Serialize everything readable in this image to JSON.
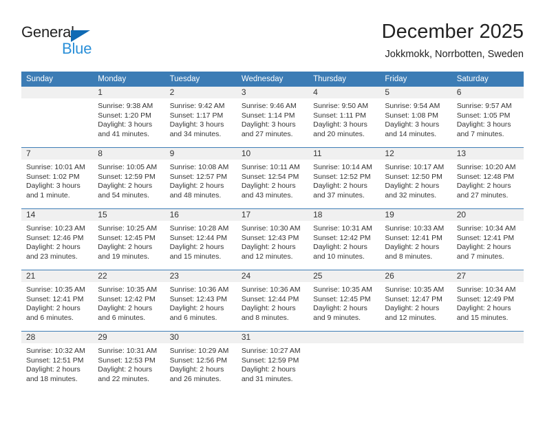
{
  "brand": {
    "name_top": "General",
    "name_bottom": "Blue",
    "accent_color": "#0f6ab4",
    "blue_text_color": "#2a8fd8"
  },
  "header": {
    "month_title": "December 2025",
    "location": "Jokkmokk, Norrbotten, Sweden"
  },
  "calendar": {
    "header_bg": "#3c7cb5",
    "daynum_band_bg": "#f0f0f0",
    "weekday_headers": [
      "Sunday",
      "Monday",
      "Tuesday",
      "Wednesday",
      "Thursday",
      "Friday",
      "Saturday"
    ],
    "weeks": [
      [
        {
          "day": "",
          "lines": []
        },
        {
          "day": "1",
          "lines": [
            "Sunrise: 9:38 AM",
            "Sunset: 1:20 PM",
            "Daylight: 3 hours",
            "and 41 minutes."
          ]
        },
        {
          "day": "2",
          "lines": [
            "Sunrise: 9:42 AM",
            "Sunset: 1:17 PM",
            "Daylight: 3 hours",
            "and 34 minutes."
          ]
        },
        {
          "day": "3",
          "lines": [
            "Sunrise: 9:46 AM",
            "Sunset: 1:14 PM",
            "Daylight: 3 hours",
            "and 27 minutes."
          ]
        },
        {
          "day": "4",
          "lines": [
            "Sunrise: 9:50 AM",
            "Sunset: 1:11 PM",
            "Daylight: 3 hours",
            "and 20 minutes."
          ]
        },
        {
          "day": "5",
          "lines": [
            "Sunrise: 9:54 AM",
            "Sunset: 1:08 PM",
            "Daylight: 3 hours",
            "and 14 minutes."
          ]
        },
        {
          "day": "6",
          "lines": [
            "Sunrise: 9:57 AM",
            "Sunset: 1:05 PM",
            "Daylight: 3 hours",
            "and 7 minutes."
          ]
        }
      ],
      [
        {
          "day": "7",
          "lines": [
            "Sunrise: 10:01 AM",
            "Sunset: 1:02 PM",
            "Daylight: 3 hours",
            "and 1 minute."
          ]
        },
        {
          "day": "8",
          "lines": [
            "Sunrise: 10:05 AM",
            "Sunset: 12:59 PM",
            "Daylight: 2 hours",
            "and 54 minutes."
          ]
        },
        {
          "day": "9",
          "lines": [
            "Sunrise: 10:08 AM",
            "Sunset: 12:57 PM",
            "Daylight: 2 hours",
            "and 48 minutes."
          ]
        },
        {
          "day": "10",
          "lines": [
            "Sunrise: 10:11 AM",
            "Sunset: 12:54 PM",
            "Daylight: 2 hours",
            "and 43 minutes."
          ]
        },
        {
          "day": "11",
          "lines": [
            "Sunrise: 10:14 AM",
            "Sunset: 12:52 PM",
            "Daylight: 2 hours",
            "and 37 minutes."
          ]
        },
        {
          "day": "12",
          "lines": [
            "Sunrise: 10:17 AM",
            "Sunset: 12:50 PM",
            "Daylight: 2 hours",
            "and 32 minutes."
          ]
        },
        {
          "day": "13",
          "lines": [
            "Sunrise: 10:20 AM",
            "Sunset: 12:48 PM",
            "Daylight: 2 hours",
            "and 27 minutes."
          ]
        }
      ],
      [
        {
          "day": "14",
          "lines": [
            "Sunrise: 10:23 AM",
            "Sunset: 12:46 PM",
            "Daylight: 2 hours",
            "and 23 minutes."
          ]
        },
        {
          "day": "15",
          "lines": [
            "Sunrise: 10:25 AM",
            "Sunset: 12:45 PM",
            "Daylight: 2 hours",
            "and 19 minutes."
          ]
        },
        {
          "day": "16",
          "lines": [
            "Sunrise: 10:28 AM",
            "Sunset: 12:44 PM",
            "Daylight: 2 hours",
            "and 15 minutes."
          ]
        },
        {
          "day": "17",
          "lines": [
            "Sunrise: 10:30 AM",
            "Sunset: 12:43 PM",
            "Daylight: 2 hours",
            "and 12 minutes."
          ]
        },
        {
          "day": "18",
          "lines": [
            "Sunrise: 10:31 AM",
            "Sunset: 12:42 PM",
            "Daylight: 2 hours",
            "and 10 minutes."
          ]
        },
        {
          "day": "19",
          "lines": [
            "Sunrise: 10:33 AM",
            "Sunset: 12:41 PM",
            "Daylight: 2 hours",
            "and 8 minutes."
          ]
        },
        {
          "day": "20",
          "lines": [
            "Sunrise: 10:34 AM",
            "Sunset: 12:41 PM",
            "Daylight: 2 hours",
            "and 7 minutes."
          ]
        }
      ],
      [
        {
          "day": "21",
          "lines": [
            "Sunrise: 10:35 AM",
            "Sunset: 12:41 PM",
            "Daylight: 2 hours",
            "and 6 minutes."
          ]
        },
        {
          "day": "22",
          "lines": [
            "Sunrise: 10:35 AM",
            "Sunset: 12:42 PM",
            "Daylight: 2 hours",
            "and 6 minutes."
          ]
        },
        {
          "day": "23",
          "lines": [
            "Sunrise: 10:36 AM",
            "Sunset: 12:43 PM",
            "Daylight: 2 hours",
            "and 6 minutes."
          ]
        },
        {
          "day": "24",
          "lines": [
            "Sunrise: 10:36 AM",
            "Sunset: 12:44 PM",
            "Daylight: 2 hours",
            "and 8 minutes."
          ]
        },
        {
          "day": "25",
          "lines": [
            "Sunrise: 10:35 AM",
            "Sunset: 12:45 PM",
            "Daylight: 2 hours",
            "and 9 minutes."
          ]
        },
        {
          "day": "26",
          "lines": [
            "Sunrise: 10:35 AM",
            "Sunset: 12:47 PM",
            "Daylight: 2 hours",
            "and 12 minutes."
          ]
        },
        {
          "day": "27",
          "lines": [
            "Sunrise: 10:34 AM",
            "Sunset: 12:49 PM",
            "Daylight: 2 hours",
            "and 15 minutes."
          ]
        }
      ],
      [
        {
          "day": "28",
          "lines": [
            "Sunrise: 10:32 AM",
            "Sunset: 12:51 PM",
            "Daylight: 2 hours",
            "and 18 minutes."
          ]
        },
        {
          "day": "29",
          "lines": [
            "Sunrise: 10:31 AM",
            "Sunset: 12:53 PM",
            "Daylight: 2 hours",
            "and 22 minutes."
          ]
        },
        {
          "day": "30",
          "lines": [
            "Sunrise: 10:29 AM",
            "Sunset: 12:56 PM",
            "Daylight: 2 hours",
            "and 26 minutes."
          ]
        },
        {
          "day": "31",
          "lines": [
            "Sunrise: 10:27 AM",
            "Sunset: 12:59 PM",
            "Daylight: 2 hours",
            "and 31 minutes."
          ]
        },
        {
          "day": "",
          "lines": []
        },
        {
          "day": "",
          "lines": []
        },
        {
          "day": "",
          "lines": []
        }
      ]
    ]
  }
}
